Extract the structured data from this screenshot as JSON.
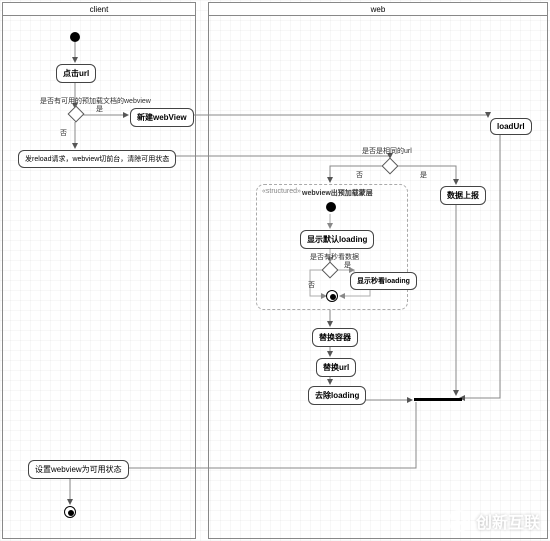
{
  "lanes": {
    "client": {
      "title": "client"
    },
    "web": {
      "title": "web"
    }
  },
  "nodes": {
    "click_url": "点击url",
    "new_webview": "新建webView",
    "reload_req": "发reload请求，webview切前台，清除可用状态",
    "load_url": "loadUrl",
    "data_report": "数据上报",
    "overlay_title": "webview出预加载蒙层",
    "show_default_loading": "显示默认loading",
    "show_seckill_loading": "显示秒看loading",
    "replace_container": "替换容器",
    "replace_url": "替换url",
    "remove_loading": "去除loading",
    "set_webview_usable": "设置webview为可用状态"
  },
  "labels": {
    "decision_preload": "是否有可用的预加载文档的webview",
    "decision_same_url": "是否是相同的url",
    "decision_seckill": "是否有秒看数据",
    "yes": "是",
    "no": "否",
    "structured_tag": "«structured»"
  },
  "watermark": "创新互联"
}
